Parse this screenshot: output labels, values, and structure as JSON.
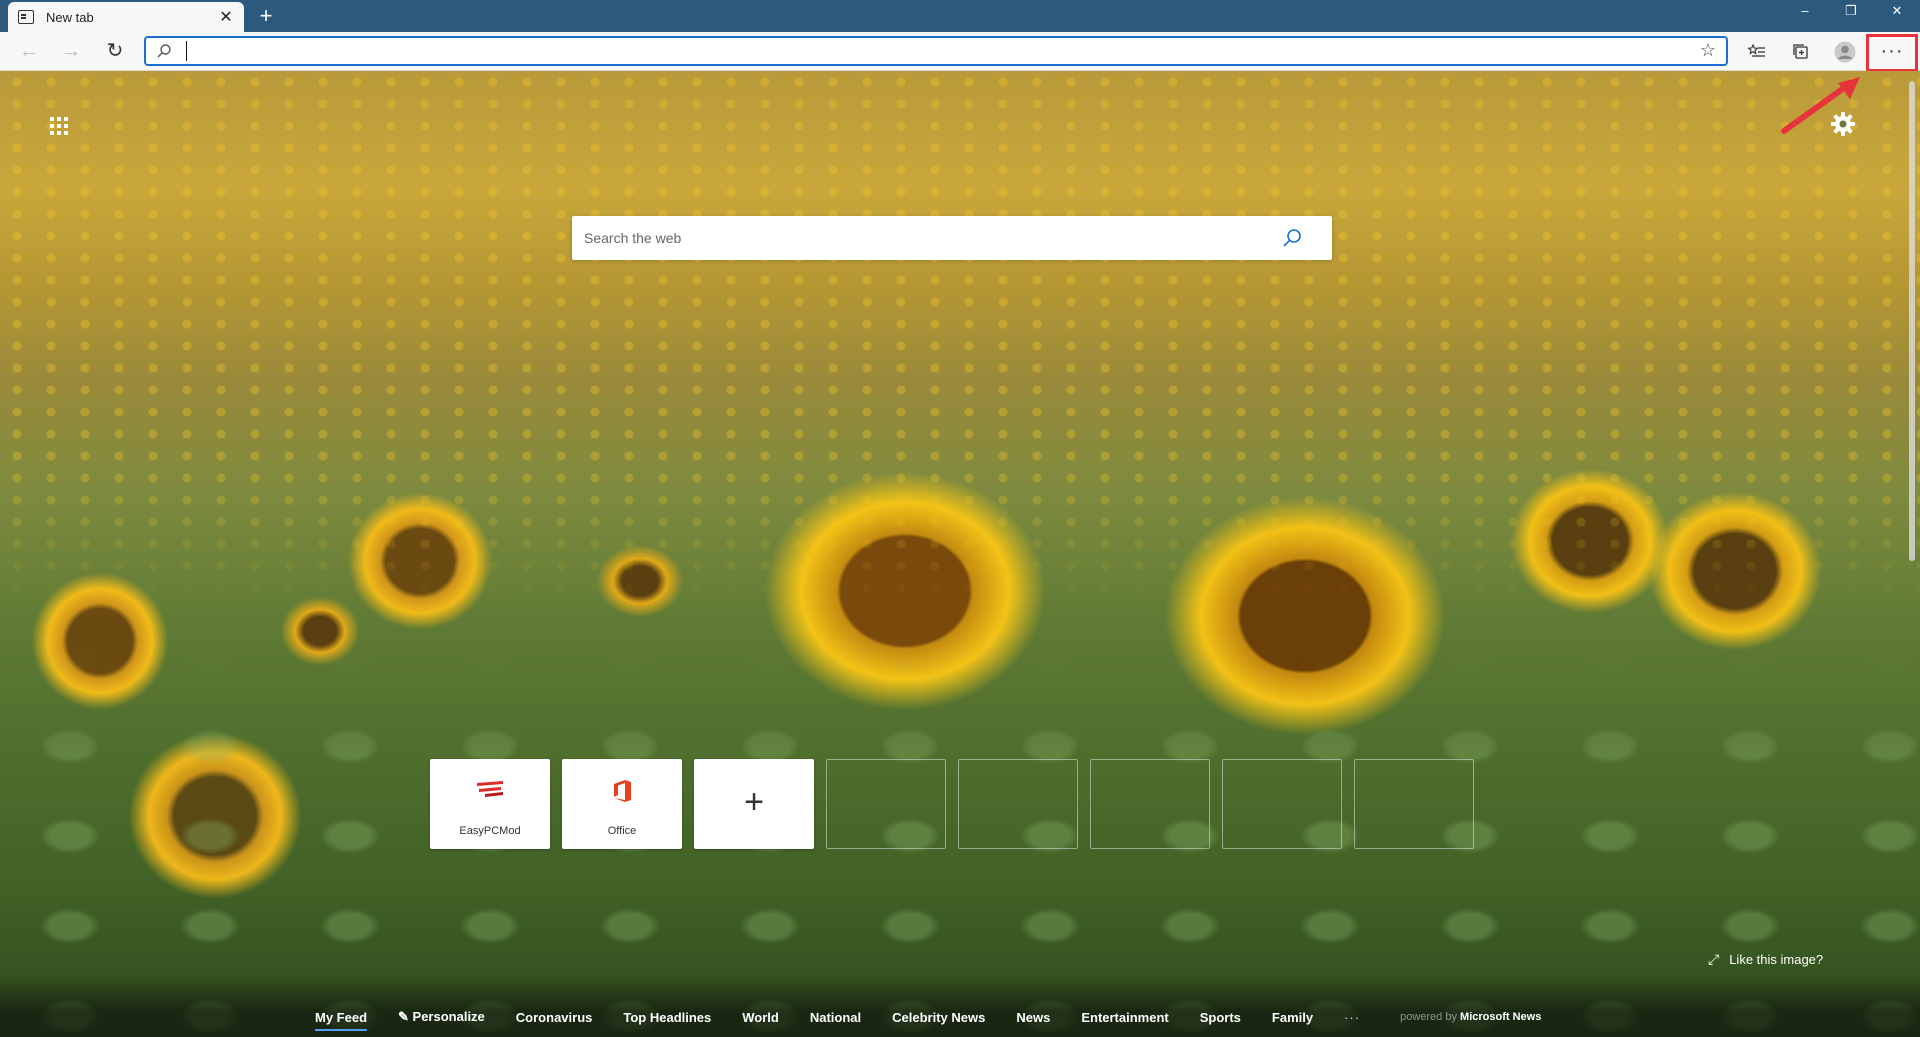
{
  "tab": {
    "title": "New tab"
  },
  "window_controls": {
    "minimize": "–",
    "restore": "❐",
    "close": "✕"
  },
  "address_bar": {
    "value": "",
    "placeholder": ""
  },
  "search": {
    "placeholder": "Search the web"
  },
  "tiles": [
    {
      "label": "EasyPCMod",
      "icon": "easypcmod-logo"
    },
    {
      "label": "Office",
      "icon": "office-logo"
    },
    {
      "label": "+",
      "icon": "add-site-icon"
    }
  ],
  "like_image": {
    "label": "Like this image?"
  },
  "feed_nav": {
    "items": [
      "My Feed",
      "Personalize",
      "Coronavirus",
      "Top Headlines",
      "World",
      "National",
      "Celebrity News",
      "News",
      "Entertainment",
      "Sports",
      "Family"
    ],
    "more": "···",
    "powered_prefix": "powered by",
    "powered_brand": "Microsoft News"
  },
  "colors": {
    "highlight": "#e8323c",
    "accent": "#1a6fd3",
    "titlebar": "#2b5a7e"
  }
}
